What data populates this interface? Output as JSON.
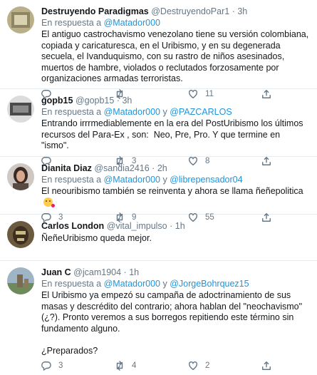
{
  "tweets": [
    {
      "name": "Destruyendo Paradigmas",
      "handle": "@DestruyendoPar1",
      "sep": "·",
      "time": "3h",
      "reply_prefix": "En respuesta a",
      "reply_users": [
        "@Matador000"
      ],
      "reply_joiner": "",
      "text": "El antiguo castrochavismo venezolano tiene su versión colombiana, copiada y caricaturesca, en el Uribismo, y en su degenerada secuela, el Ivanduquismo, con su rastro de niños asesinados, muertos de hambre, violados o reclutados forzosamente por organizaciones armadas terroristas.",
      "counts": {
        "reply": "",
        "retweet": "",
        "like": "11"
      }
    },
    {
      "name": "gopb15",
      "handle": "@gopb15",
      "sep": "·",
      "time": "3h",
      "reply_prefix": "En respuesta a",
      "reply_users": [
        "@Matador000",
        "@PAZCARLOS"
      ],
      "reply_joiner": "y",
      "text": "Entrando irrrmediablemente en la era del PostUribismo los últimos recursos del Para-Ex , son:  Neo, Pre, Pro. Y que termine en   \"ismo\".",
      "counts": {
        "reply": "",
        "retweet": "3",
        "like": "8"
      }
    },
    {
      "name": "Dianita Diaz",
      "handle": "@sandia2416",
      "sep": "·",
      "time": "2h",
      "reply_prefix": "En respuesta a",
      "reply_users": [
        "@Matador000",
        "@librepensador04"
      ],
      "reply_joiner": "y",
      "text": "El neouribismo también se reinventa y ahora se llama ñeñepolitica",
      "counts": {
        "reply": "3",
        "retweet": "9",
        "like": "55"
      }
    },
    {
      "name": "Carlos London",
      "handle": "@vital_impulso",
      "sep": "·",
      "time": "1h",
      "reply_prefix": "",
      "reply_users": [],
      "reply_joiner": "",
      "text": "ÑeñeUribismo queda mejor.",
      "counts": {
        "reply": "",
        "retweet": "",
        "like": ""
      }
    },
    {
      "name": "Juan C",
      "handle": "@jcam1904",
      "sep": "·",
      "time": "1h",
      "reply_prefix": "En respuesta a",
      "reply_users": [
        "@Matador000",
        "@JorgeBohrquez15"
      ],
      "reply_joiner": "y",
      "text": "El Uribismo ya empezó su campaña de adoctrinamiento de sus masas y descrédito del contrario; ahora hablan del \"neochavismo\" (¿?). Pronto veremos a sus borregos repitiendo este término sin fundamento alguno.\n\n¿Preparados?",
      "counts": {
        "reply": "3",
        "retweet": "4",
        "like": "2"
      }
    }
  ],
  "icons": [
    "reply-icon",
    "retweet-icon",
    "like-icon",
    "share-icon"
  ],
  "colors": {
    "link": "#1b95e0",
    "muted": "#657786",
    "text": "#14171a",
    "divider": "#e6ecf0"
  }
}
